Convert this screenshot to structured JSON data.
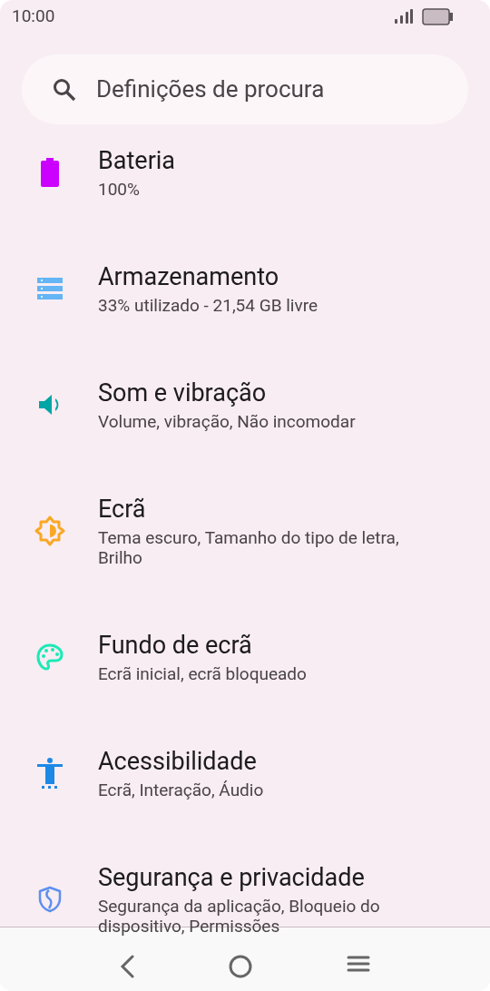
{
  "status_bar": {
    "time": "10:00"
  },
  "search": {
    "placeholder": "Definições de procura"
  },
  "items": [
    {
      "kind": "battery",
      "title": "Bateria",
      "subtitle": "100%"
    },
    {
      "kind": "storage",
      "title": "Armazenamento",
      "subtitle": "33% utilizado - 21,54 GB livre"
    },
    {
      "kind": "sound",
      "title": "Som e vibração",
      "subtitle": "Volume, vibração, Não incomodar"
    },
    {
      "kind": "display",
      "title": "Ecrã",
      "subtitle": "Tema escuro, Tamanho do tipo de letra, Brilho"
    },
    {
      "kind": "wallpaper",
      "title": "Fundo de ecrã",
      "subtitle": "Ecrã inicial, ecrã bloqueado"
    },
    {
      "kind": "accessibility",
      "title": "Acessibilidade",
      "subtitle": "Ecrã, Interação, Áudio"
    },
    {
      "kind": "security",
      "title": "Segurança e privacidade",
      "subtitle": "Segurança da aplicação, Bloqueio do dispositivo, Permissões"
    }
  ]
}
